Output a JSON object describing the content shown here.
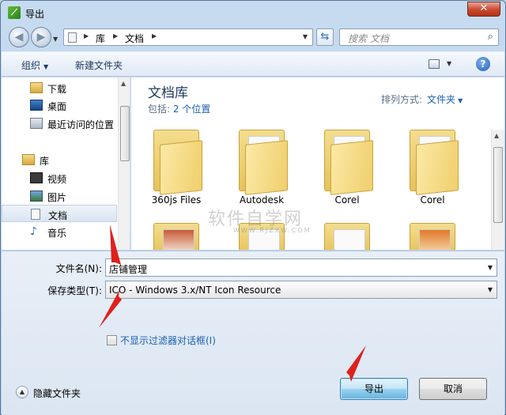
{
  "window": {
    "title": "导出",
    "close": "✕"
  },
  "nav": {
    "breadcrumbs": [
      "库",
      "文档"
    ],
    "search_placeholder": "搜索 文档"
  },
  "toolbar": {
    "organize": "组织",
    "new_folder": "新建文件夹",
    "help": "?"
  },
  "sidebar": {
    "items": [
      {
        "label": "下载",
        "icon": "download-folder-icon"
      },
      {
        "label": "桌面",
        "icon": "desktop-icon"
      },
      {
        "label": "最近访问的位置",
        "icon": "recent-places-icon"
      },
      {
        "label": "库",
        "icon": "library-icon"
      },
      {
        "label": "视频",
        "icon": "video-icon"
      },
      {
        "label": "图片",
        "icon": "pictures-icon"
      },
      {
        "label": "文档",
        "icon": "documents-icon",
        "selected": true
      },
      {
        "label": "音乐",
        "icon": "music-icon"
      }
    ]
  },
  "library": {
    "title": "文档库",
    "includes_label": "包括:",
    "includes_link": "2 个位置",
    "arrange_label": "排列方式:",
    "arrange_value": "文件夹"
  },
  "folders": [
    "360js Files",
    "Autodesk",
    "Corel",
    "Corel"
  ],
  "watermark": {
    "main": "软件自学网",
    "sub": "WWW.RJZXW.COM"
  },
  "form": {
    "filename_label": "文件名(N):",
    "filename_value": "店铺管理",
    "type_label": "保存类型(T):",
    "type_value": "ICO - Windows 3.x/NT Icon Resource",
    "checkbox_label": "不显示过滤器对话框(I)"
  },
  "footer": {
    "hide_folders": "隐藏文件夹",
    "export": "导出",
    "cancel": "取消"
  },
  "colors": {
    "accent": "#1a5fb4",
    "annotation_arrow": "#e0201b"
  }
}
